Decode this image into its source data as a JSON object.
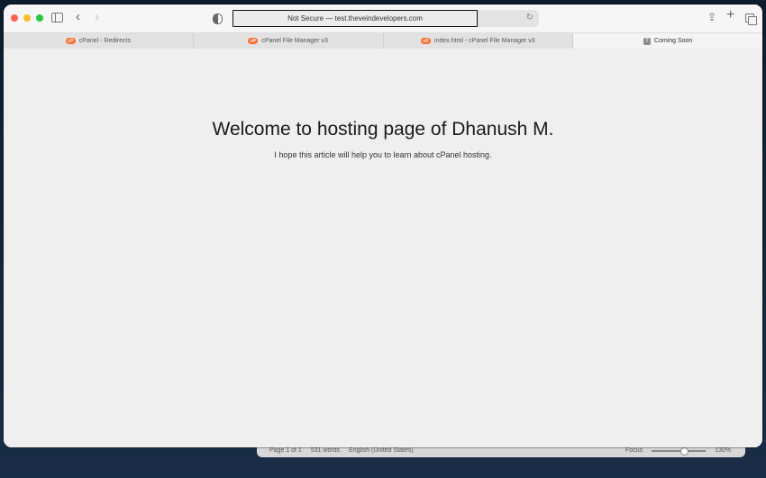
{
  "browser": {
    "url_display": "Not Secure — test.theveindevelopers.com",
    "icons": [
      "sidebar-icon",
      "back-icon",
      "forward-icon",
      "privacy-shield-icon",
      "reload-icon",
      "share-icon",
      "new-tab-icon",
      "tab-overview-icon"
    ],
    "back_glyph": "‹",
    "forward_glyph": "›",
    "reload_glyph": "↻",
    "share_glyph": "⇪",
    "plus_glyph": "+"
  },
  "tabs": [
    {
      "label": "cPanel - Redirects",
      "favicon": "cP"
    },
    {
      "label": "cPanel File Manager v3",
      "favicon": "cP"
    },
    {
      "label": "index.html - cPanel File Manager v3",
      "favicon": "cP"
    },
    {
      "label": "Coming Soon",
      "favicon": "T",
      "active": true
    }
  ],
  "page": {
    "heading": "Welcome to hosting page of Dhanush M.",
    "paragraph": "I hope this article will help you to learn about cPanel hosting."
  },
  "word_status_bar": {
    "page": "Page 1 of 1",
    "words": "531 words",
    "language": "English (United States)",
    "focus": "Focus",
    "zoom": "130%"
  },
  "colors": {
    "traffic_red": "#fe5f57",
    "traffic_yellow": "#febc2e",
    "traffic_green": "#28c840",
    "cpanel_orange": "#ff6c2c"
  }
}
